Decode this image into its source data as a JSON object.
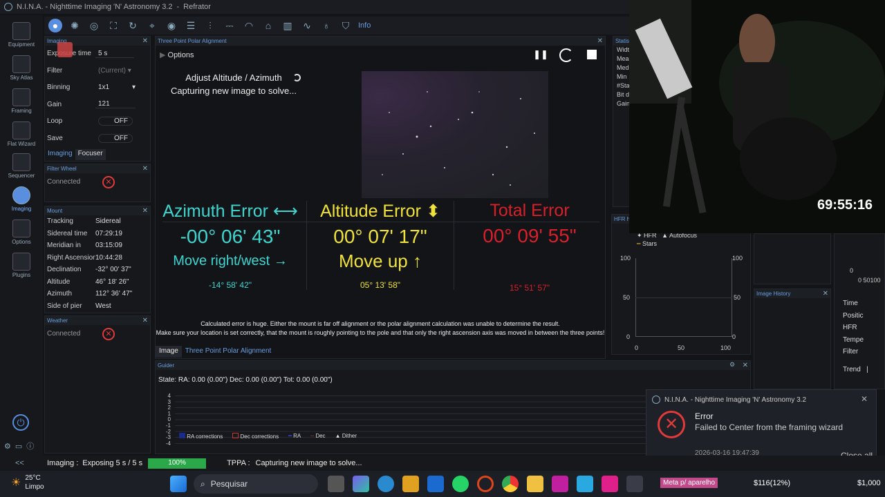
{
  "titlebar": {
    "title": "N.I.N.A. - Nighttime Imaging 'N' Astronomy 3.2",
    "profile": "Refrator"
  },
  "nav": [
    {
      "label": "Equipment",
      "icon": "camera-icon"
    },
    {
      "label": "Sky Atlas",
      "icon": "atlas-icon"
    },
    {
      "label": "Framing",
      "icon": "framing-icon"
    },
    {
      "label": "Flat Wizard",
      "icon": "flat-wizard-icon"
    },
    {
      "label": "Sequencer",
      "icon": "sequencer-icon"
    },
    {
      "label": "Imaging",
      "icon": "imaging-icon"
    },
    {
      "label": "Options",
      "icon": "gear-icon"
    },
    {
      "label": "Plugins",
      "icon": "puzzle-icon"
    }
  ],
  "toolbar": {
    "info_label": "Info"
  },
  "imaging_panel": {
    "title": "Imaging",
    "rows": [
      {
        "k": "Exposure time",
        "v": "5",
        "unit": "s"
      },
      {
        "k": "Filter",
        "v": "(Current)"
      },
      {
        "k": "Binning",
        "v": "1x1"
      },
      {
        "k": "Gain",
        "v": "121"
      },
      {
        "k": "Loop",
        "v": "OFF"
      },
      {
        "k": "Save",
        "v": "OFF"
      }
    ],
    "tabs": [
      "Imaging",
      "Focuser"
    ]
  },
  "filter_wheel": {
    "title": "Filter Wheel",
    "status": "Connected"
  },
  "mount": {
    "title": "Mount",
    "rows": [
      {
        "k": "Tracking",
        "v": "Sidereal"
      },
      {
        "k": "Sidereal time",
        "v": "07:29:19"
      },
      {
        "k": "Meridian in",
        "v": "03:15:09"
      },
      {
        "k": "Right Ascension",
        "v": "10:44:28"
      },
      {
        "k": "Declination",
        "v": "-32° 00' 37\""
      },
      {
        "k": "Altitude",
        "v": "46° 18' 26\""
      },
      {
        "k": "Azimuth",
        "v": "112° 36' 47\""
      },
      {
        "k": "Side of pier",
        "v": "West"
      }
    ]
  },
  "weather": {
    "title": "Weather",
    "status": "Connected"
  },
  "tppa": {
    "panel_title": "Three Point Polar Alignment",
    "options_label": "Options",
    "step_title": "Adjust Altitude / Azimuth",
    "step_status": "Capturing new image to solve...",
    "azimuth": {
      "title": "Azimuth Error",
      "arrow": "⟷",
      "value": "-00° 06' 43\"",
      "move": "Move right/west",
      "move_arrow": "→",
      "sub": "-14° 58' 42\"",
      "color": "#3fd6d0"
    },
    "altitude": {
      "title": "Altitude Error",
      "arrow": "⬍",
      "value": "00° 07' 17\"",
      "move": "Move up",
      "move_arrow": "↑",
      "sub": "05° 13' 58\"",
      "color": "#f0e23a"
    },
    "total": {
      "title": "Total Error",
      "value": "00° 09' 55\"",
      "sub": "15° 51' 57\"",
      "color": "#d9202a"
    },
    "note1": "Calculated error is huge. Either the mount is far off alignment or the polar alignment calculation was unable to determine the result.",
    "note2": "Make sure your location is set correctly, that the mount is roughly pointing to the pole and that only the right ascension axis was moved in between the three points!",
    "tabs": [
      "Image",
      "Three Point Polar Alignment"
    ]
  },
  "statistics": {
    "title": "Statisti",
    "rows": [
      "Widt",
      "Mea",
      "Med",
      "Min",
      "#Sta",
      "Bit d",
      "Gain"
    ]
  },
  "hfr": {
    "title": "HFR h",
    "legend": [
      "HFR",
      "Autofocus",
      "Stars"
    ],
    "y_left": [
      "100",
      "50",
      "0"
    ],
    "y_right": [
      "100",
      "50",
      "0"
    ],
    "x_ticks": [
      "0",
      "50",
      "100"
    ]
  },
  "image_history": {
    "title": "Image History"
  },
  "right_props": {
    "rows": [
      "Time",
      "Positic",
      "HFR",
      "Tempe",
      "Filter"
    ],
    "trend": "Trend",
    "trend_value": "|",
    "axis0": "0",
    "axis_label": "0 50100"
  },
  "guider": {
    "title": "Guider",
    "state": "State:  RA: 0.00 (0.00\")  Dec: 0.00 (0.00\")  Tot: 0.00 (0.00\")",
    "y_ticks": [
      "4",
      "3",
      "2",
      "1",
      "0",
      "-1",
      "-2",
      "-3",
      "-4"
    ],
    "legend": [
      "RA corrections",
      "Dec corrections",
      "RA",
      "Dec",
      "Dither"
    ]
  },
  "webcam": {
    "timer": "69:55:16"
  },
  "toast": {
    "app": "N.I.N.A. - Nighttime Imaging 'N' Astronomy 3.2",
    "title": "Error",
    "message": "Failed to Center from the framing wizard",
    "timestamp": "2026-03-16 19:47:39",
    "close_all": "Close all"
  },
  "statusbar": {
    "imaging_label": "Imaging :",
    "imaging_text": "Exposing 5 s / 5 s",
    "progress_label": "100%",
    "progress": 1.0,
    "tppa_label": "TPPA :",
    "tppa_text": "Capturing new image to solve..."
  },
  "taskbar": {
    "weather_temp": "25°C",
    "weather_text": "Limpo",
    "search": "Pesquisar",
    "meta_label": "Meta p/ aparelho",
    "stock1": "$116(12%)",
    "stock2": "$1,000"
  }
}
